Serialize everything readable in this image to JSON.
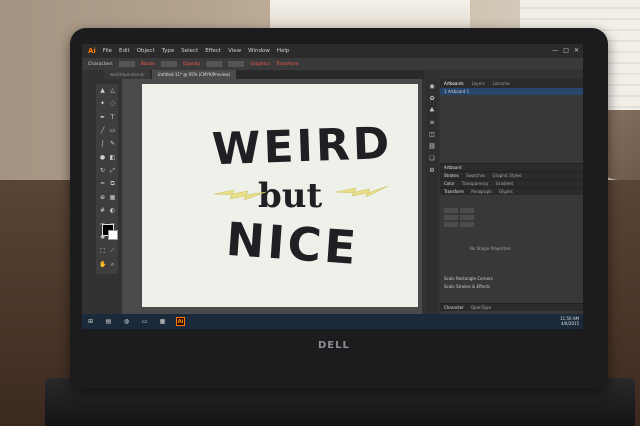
{
  "app": {
    "logo": "Ai",
    "menu": [
      "File",
      "Edit",
      "Object",
      "Type",
      "Select",
      "Effect",
      "View",
      "Window",
      "Help"
    ],
    "window_controls": [
      "—",
      "□",
      "✕"
    ]
  },
  "control_bar": {
    "left_label": "Characters",
    "stroke_label": "Stroke",
    "opacity_label": "Opacity",
    "graphics_label": "Graphics",
    "transform_label": "Transform"
  },
  "document_tabs": [
    {
      "label": "weird-but-nice.ai",
      "active": false
    },
    {
      "label": "Untitled-11* @ 95% (CMYK/Preview)",
      "active": true
    }
  ],
  "artwork": {
    "line1": "WEIRD",
    "line2": "but",
    "line3": "NICE",
    "ink_color": "#1f1f24",
    "bolt_color": "#e8df86"
  },
  "panels": {
    "tabs": [
      "Artboards",
      "Layers",
      "Libraries"
    ],
    "artboard_row": "1    Artboard 1",
    "sections": [
      "Artboard",
      "Strokes",
      "Color",
      "Transform"
    ],
    "sub_tabs_strokes": [
      "Swatches",
      "Graphic Styles"
    ],
    "sub_tabs_color": [
      "Transparency",
      "Gradient"
    ],
    "sub_tabs_transform": [
      "Paragraph",
      "Glyphs"
    ],
    "no_shape": "No Shape Properties",
    "options": [
      "Scale Rectangle Corners",
      "Scale Strokes & Effects"
    ],
    "bottom_tab": "Character",
    "bottom_tab2": "OpenType"
  },
  "taskbar": {
    "ai_icon": "Ai",
    "time": "11:50 AM",
    "date": "4/6/2015"
  },
  "device": {
    "brand": "DELL"
  }
}
